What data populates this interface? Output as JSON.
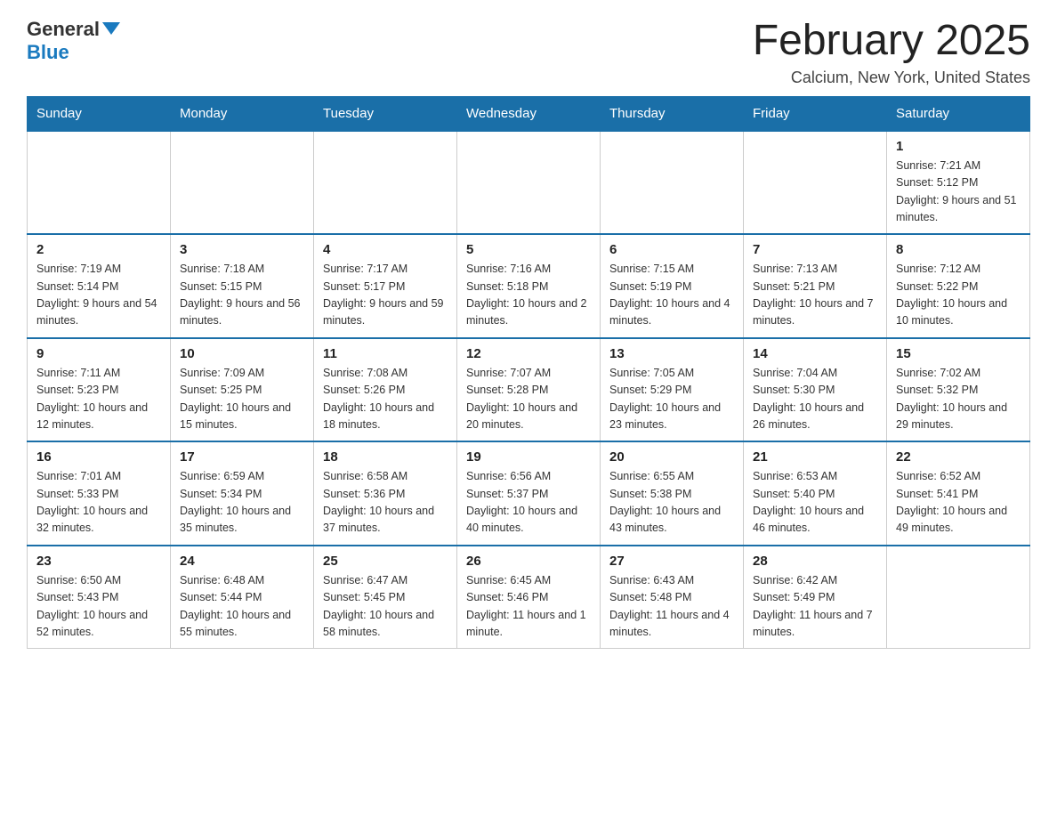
{
  "logo": {
    "general": "General",
    "blue": "Blue"
  },
  "header": {
    "title": "February 2025",
    "location": "Calcium, New York, United States"
  },
  "days_of_week": [
    "Sunday",
    "Monday",
    "Tuesday",
    "Wednesday",
    "Thursday",
    "Friday",
    "Saturday"
  ],
  "weeks": [
    [
      {
        "day": "",
        "info": ""
      },
      {
        "day": "",
        "info": ""
      },
      {
        "day": "",
        "info": ""
      },
      {
        "day": "",
        "info": ""
      },
      {
        "day": "",
        "info": ""
      },
      {
        "day": "",
        "info": ""
      },
      {
        "day": "1",
        "info": "Sunrise: 7:21 AM\nSunset: 5:12 PM\nDaylight: 9 hours and 51 minutes."
      }
    ],
    [
      {
        "day": "2",
        "info": "Sunrise: 7:19 AM\nSunset: 5:14 PM\nDaylight: 9 hours and 54 minutes."
      },
      {
        "day": "3",
        "info": "Sunrise: 7:18 AM\nSunset: 5:15 PM\nDaylight: 9 hours and 56 minutes."
      },
      {
        "day": "4",
        "info": "Sunrise: 7:17 AM\nSunset: 5:17 PM\nDaylight: 9 hours and 59 minutes."
      },
      {
        "day": "5",
        "info": "Sunrise: 7:16 AM\nSunset: 5:18 PM\nDaylight: 10 hours and 2 minutes."
      },
      {
        "day": "6",
        "info": "Sunrise: 7:15 AM\nSunset: 5:19 PM\nDaylight: 10 hours and 4 minutes."
      },
      {
        "day": "7",
        "info": "Sunrise: 7:13 AM\nSunset: 5:21 PM\nDaylight: 10 hours and 7 minutes."
      },
      {
        "day": "8",
        "info": "Sunrise: 7:12 AM\nSunset: 5:22 PM\nDaylight: 10 hours and 10 minutes."
      }
    ],
    [
      {
        "day": "9",
        "info": "Sunrise: 7:11 AM\nSunset: 5:23 PM\nDaylight: 10 hours and 12 minutes."
      },
      {
        "day": "10",
        "info": "Sunrise: 7:09 AM\nSunset: 5:25 PM\nDaylight: 10 hours and 15 minutes."
      },
      {
        "day": "11",
        "info": "Sunrise: 7:08 AM\nSunset: 5:26 PM\nDaylight: 10 hours and 18 minutes."
      },
      {
        "day": "12",
        "info": "Sunrise: 7:07 AM\nSunset: 5:28 PM\nDaylight: 10 hours and 20 minutes."
      },
      {
        "day": "13",
        "info": "Sunrise: 7:05 AM\nSunset: 5:29 PM\nDaylight: 10 hours and 23 minutes."
      },
      {
        "day": "14",
        "info": "Sunrise: 7:04 AM\nSunset: 5:30 PM\nDaylight: 10 hours and 26 minutes."
      },
      {
        "day": "15",
        "info": "Sunrise: 7:02 AM\nSunset: 5:32 PM\nDaylight: 10 hours and 29 minutes."
      }
    ],
    [
      {
        "day": "16",
        "info": "Sunrise: 7:01 AM\nSunset: 5:33 PM\nDaylight: 10 hours and 32 minutes."
      },
      {
        "day": "17",
        "info": "Sunrise: 6:59 AM\nSunset: 5:34 PM\nDaylight: 10 hours and 35 minutes."
      },
      {
        "day": "18",
        "info": "Sunrise: 6:58 AM\nSunset: 5:36 PM\nDaylight: 10 hours and 37 minutes."
      },
      {
        "day": "19",
        "info": "Sunrise: 6:56 AM\nSunset: 5:37 PM\nDaylight: 10 hours and 40 minutes."
      },
      {
        "day": "20",
        "info": "Sunrise: 6:55 AM\nSunset: 5:38 PM\nDaylight: 10 hours and 43 minutes."
      },
      {
        "day": "21",
        "info": "Sunrise: 6:53 AM\nSunset: 5:40 PM\nDaylight: 10 hours and 46 minutes."
      },
      {
        "day": "22",
        "info": "Sunrise: 6:52 AM\nSunset: 5:41 PM\nDaylight: 10 hours and 49 minutes."
      }
    ],
    [
      {
        "day": "23",
        "info": "Sunrise: 6:50 AM\nSunset: 5:43 PM\nDaylight: 10 hours and 52 minutes."
      },
      {
        "day": "24",
        "info": "Sunrise: 6:48 AM\nSunset: 5:44 PM\nDaylight: 10 hours and 55 minutes."
      },
      {
        "day": "25",
        "info": "Sunrise: 6:47 AM\nSunset: 5:45 PM\nDaylight: 10 hours and 58 minutes."
      },
      {
        "day": "26",
        "info": "Sunrise: 6:45 AM\nSunset: 5:46 PM\nDaylight: 11 hours and 1 minute."
      },
      {
        "day": "27",
        "info": "Sunrise: 6:43 AM\nSunset: 5:48 PM\nDaylight: 11 hours and 4 minutes."
      },
      {
        "day": "28",
        "info": "Sunrise: 6:42 AM\nSunset: 5:49 PM\nDaylight: 11 hours and 7 minutes."
      },
      {
        "day": "",
        "info": ""
      }
    ]
  ]
}
